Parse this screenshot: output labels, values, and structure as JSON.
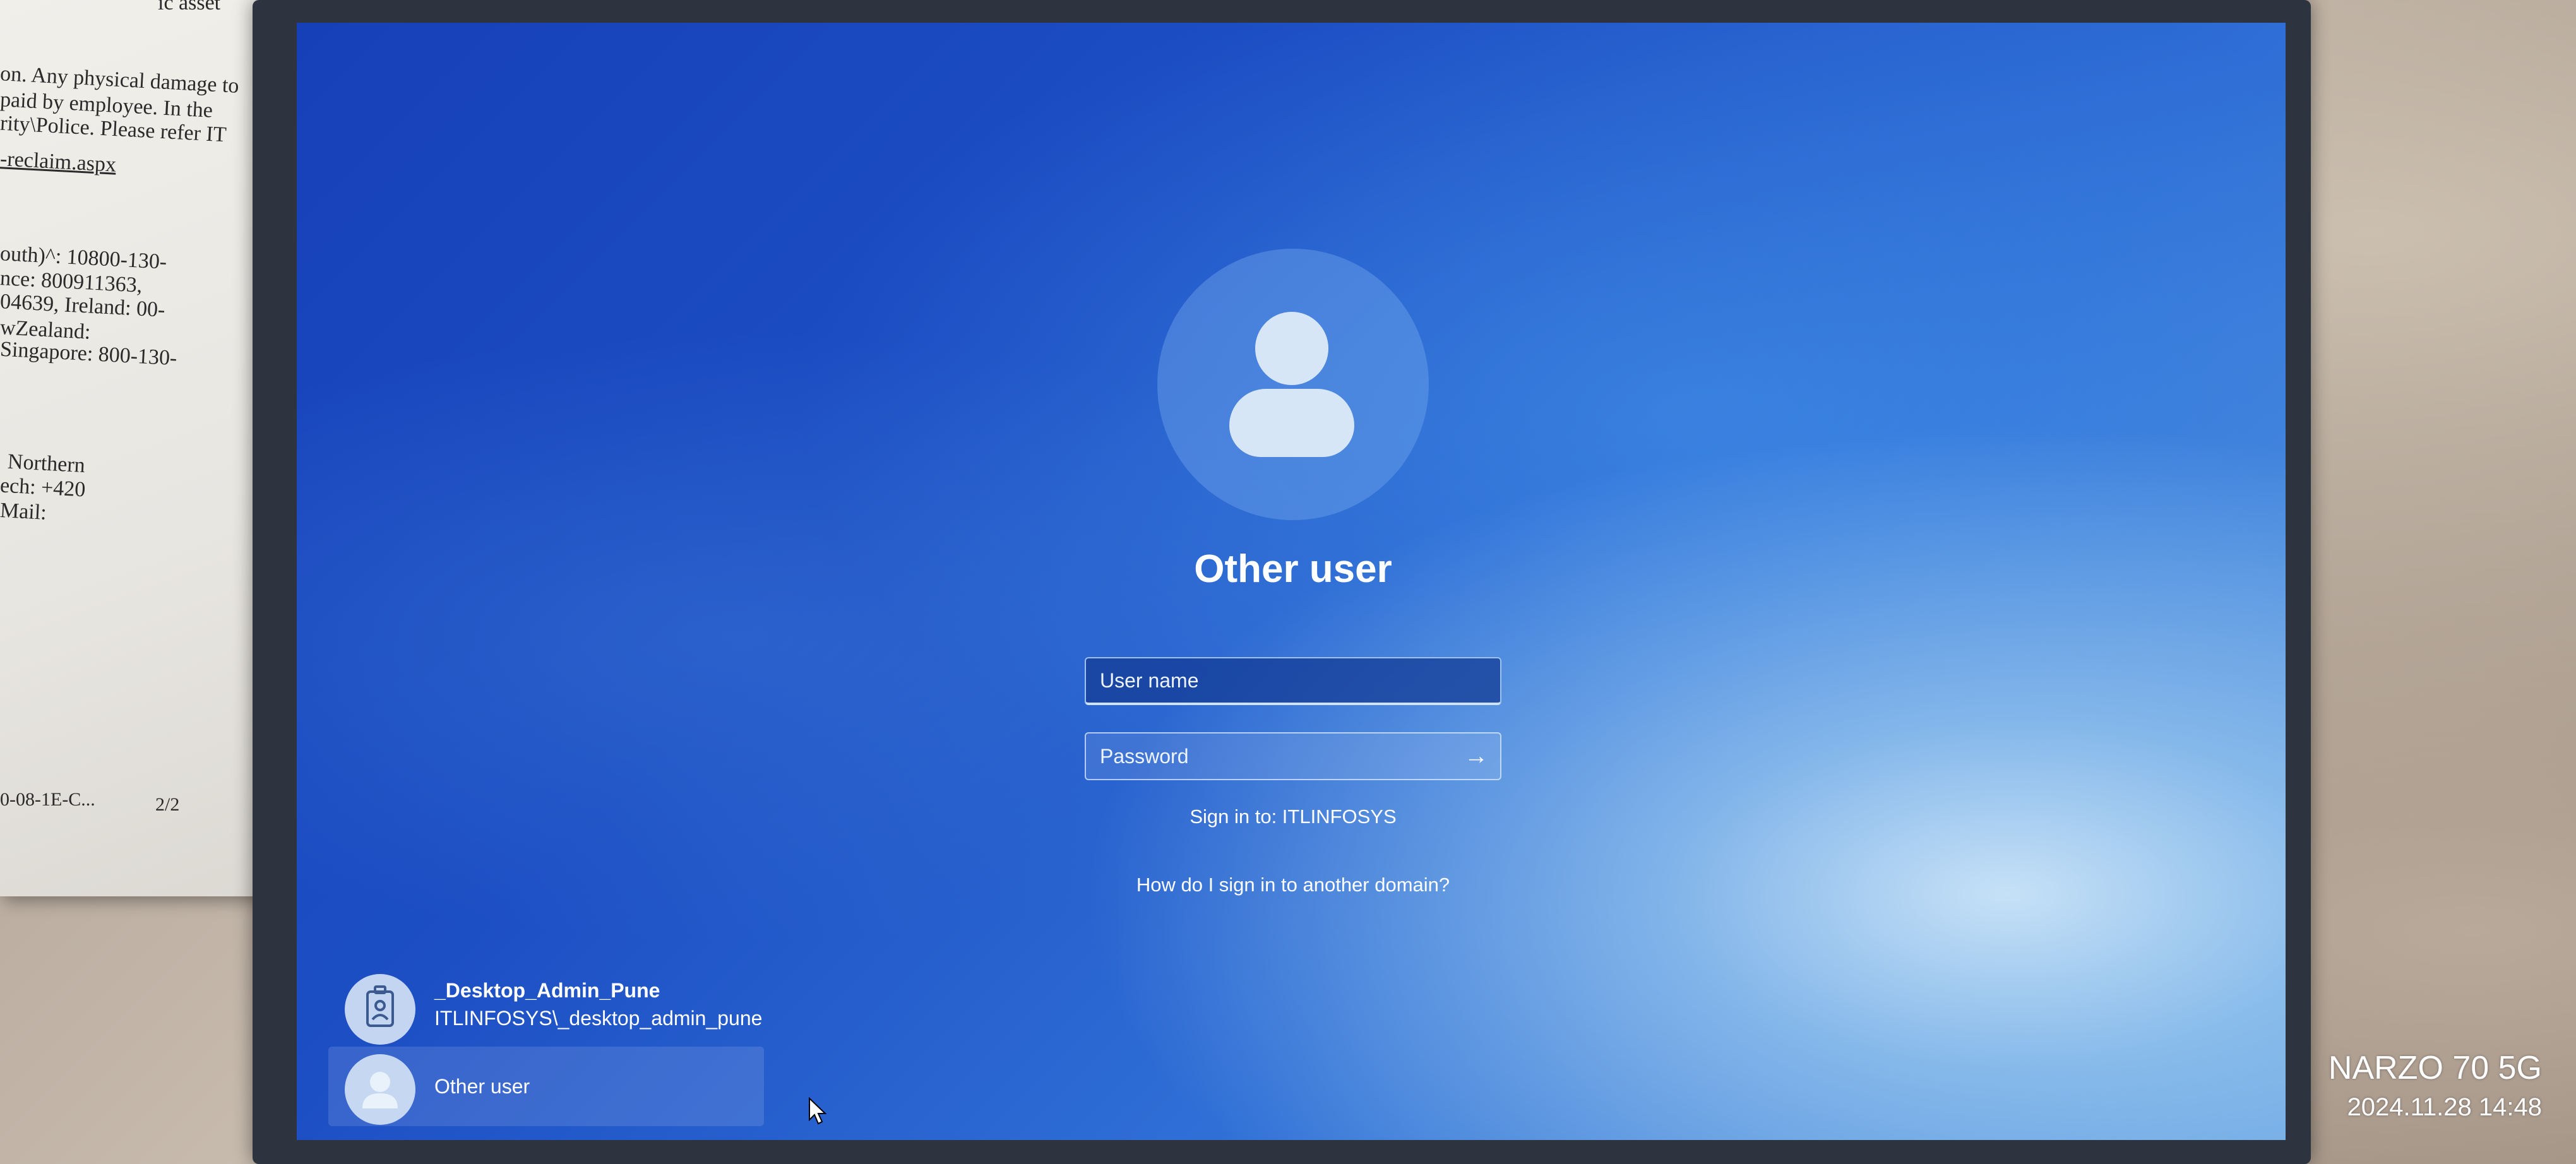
{
  "paper": {
    "lines": [
      "ic asset",
      "on. Any physical damage to",
      "paid by employee. In the",
      "rity\\Police. Please refer IT",
      "-reclaim.aspx",
      "outh)^: 10800-130-",
      "nce: 800911363,",
      "04639,  Ireland: 00-",
      "wZealand:",
      "Singapore: 800-130-",
      "Northern",
      "ech: +420",
      "Mail:",
      "0-08-1E-C...",
      "2/2"
    ]
  },
  "login": {
    "title": "Other user",
    "username_placeholder": "User name",
    "password_placeholder": "Password",
    "submit_glyph": "→",
    "sign_in_to": "Sign in to: ITLINFOSYS",
    "other_domain_link": "How do I sign in to another domain?"
  },
  "users": [
    {
      "name": "_Desktop_Admin_Pune",
      "account": "ITLINFOSYS\\_desktop_admin_pune",
      "icon": "id-badge-icon"
    },
    {
      "name": "Other user",
      "icon": "user-icon",
      "selected": true
    }
  ],
  "tray": {
    "network_icon": "network-icon",
    "accessibility_icon": "accessibility-icon"
  },
  "watermark": {
    "device": "NARZO 70 5G",
    "datetime": "2024.11.28 14:48"
  },
  "colors": {
    "screen_blue": "#1d4fc4",
    "field_border": "#9ec3f0",
    "text": "#ffffff"
  }
}
